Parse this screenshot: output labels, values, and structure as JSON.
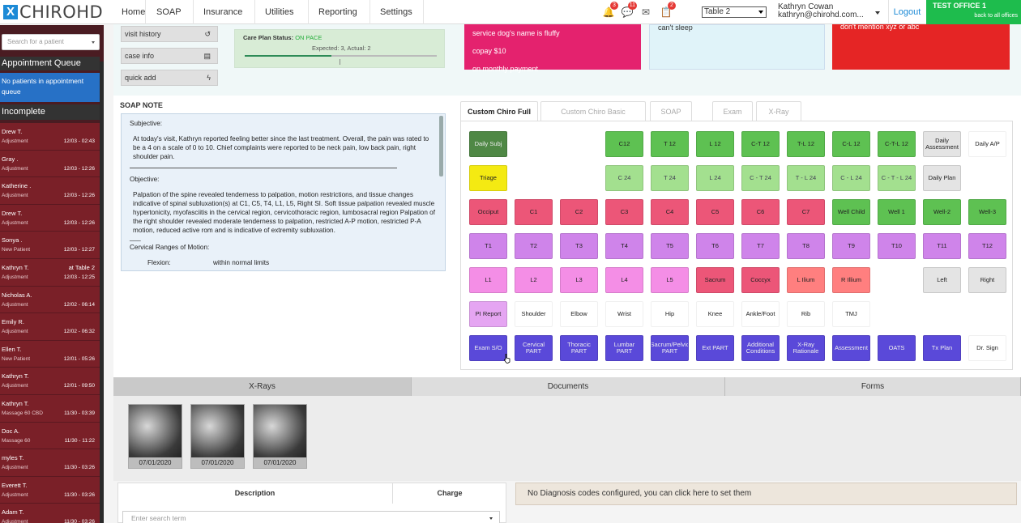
{
  "brand": {
    "logo_mark": "X",
    "logo_text": "CHIROHD"
  },
  "nav": {
    "items": [
      {
        "label": "Home",
        "dropdown": false
      },
      {
        "label": "SOAP",
        "dropdown": true
      },
      {
        "label": "Insurance",
        "dropdown": true
      },
      {
        "label": "Utilities",
        "dropdown": true
      },
      {
        "label": "Reporting",
        "dropdown": true
      },
      {
        "label": "Settings",
        "dropdown": true
      }
    ],
    "notifications": [
      {
        "icon": "bell-icon",
        "glyph": "🔔",
        "count": "3"
      },
      {
        "icon": "chat-icon",
        "glyph": "💬",
        "count": "11"
      },
      {
        "icon": "mail-icon",
        "glyph": "✉",
        "count": ""
      },
      {
        "icon": "clipboard-icon",
        "glyph": "📋",
        "count": "2"
      }
    ],
    "table_select": "Table 2",
    "user_name": "Kathryn Cowan",
    "user_email": "kathryn@chirohd.com...",
    "logout": "Logout",
    "office_title": "TEST OFFICE 1",
    "office_sub": "back to all offices"
  },
  "sidebar": {
    "search_placeholder": "Search for a patient",
    "queue_title": "Appointment Queue",
    "queue_empty": "No patients in appointment queue",
    "incomplete_title": "Incomplete",
    "patients": [
      {
        "name": "Drew T.",
        "type": "Adjustment",
        "time": "12/03 - 02:43",
        "table": ""
      },
      {
        "name": "Gray .",
        "type": "Adjustment",
        "time": "12/03 - 12:26",
        "table": ""
      },
      {
        "name": "Katherine .",
        "type": "Adjustment",
        "time": "12/03 - 12:26",
        "table": ""
      },
      {
        "name": "Drew T.",
        "type": "Adjustment",
        "time": "12/03 - 12:26",
        "table": ""
      },
      {
        "name": "Sonya .",
        "type": "New Patient",
        "time": "12/03 - 12:27",
        "table": ""
      },
      {
        "name": "Kathryn T.",
        "type": "Adjustment",
        "time": "12/03 - 12:25",
        "table": "at Table 2"
      },
      {
        "name": "Nicholas A.",
        "type": "Adjustment",
        "time": "12/02 - 06:14",
        "table": ""
      },
      {
        "name": "Emily R.",
        "type": "Adjustment",
        "time": "12/02 - 06:32",
        "table": ""
      },
      {
        "name": "Ellen T.",
        "type": "New Patient",
        "time": "12/01 - 05:26",
        "table": ""
      },
      {
        "name": "Kathryn T.",
        "type": "Adjustment",
        "time": "12/01 - 09:50",
        "table": ""
      },
      {
        "name": "Kathryn T.",
        "type": "Massage 60 CBD",
        "time": "11/30 - 03:39",
        "table": ""
      },
      {
        "name": "Doc A.",
        "type": "Massage 60",
        "time": "11/30 - 11:22",
        "table": ""
      },
      {
        "name": "myles T.",
        "type": "Adjustment",
        "time": "11/30 - 03:26",
        "table": ""
      },
      {
        "name": "Everett T.",
        "type": "Adjustment",
        "time": "11/30 - 03:26",
        "table": ""
      },
      {
        "name": "Adam T.",
        "type": "Adjustment",
        "time": "11/30 - 03:26",
        "table": ""
      }
    ]
  },
  "quick": {
    "visit_history": "visit history",
    "case_info": "case info",
    "quick_add": "quick add"
  },
  "care_plan": {
    "label": "Care Plan Status:",
    "value": "ON PACE",
    "expected": "Expected: 3, Actual: 2",
    "progress": 0.45
  },
  "notes": {
    "pink": [
      "service dog's name is fluffy",
      "copay $10",
      "on monthly payment"
    ],
    "blue": "can't sleep",
    "red": "don't mention xyz or abc"
  },
  "soap": {
    "title": "SOAP NOTE",
    "subjective_h": "Subjective:",
    "subjective": "At today's visit, Kathryn reported feeling better since the last treatment.  Overall, the pain was rated to be a 4 on a scale of 0 to 10.  Chief complaints were reported to be neck pain, low back pain, right shoulder pain.",
    "objective_h": "Objective:",
    "objective": "Palpation of the spine revealed tenderness to palpation, motion restrictions, and tissue changes indicative of spinal subluxation(s) at C1, C5, T4, L1, L5, Right SI. Soft tissue palpation revealed muscle hypertonicity,  myofasciitis in the cervical region,  cervicothoracic region,  lumbosacral region Palpation of the right shoulder revealed moderate tenderness to palpation, restricted A-P motion, restricted P-A motion, reduced active rom and is indicative of extremity subluxation.",
    "sep": "___",
    "cervical_h": "Cervical Ranges of Motion:",
    "flexion": "Flexion:",
    "flexion_v": "within normal limits"
  },
  "tabs": [
    "Custom Chiro Full",
    "Custom Chiro Basic",
    "SOAP",
    "Exam",
    "X-Ray"
  ],
  "grid": [
    [
      {
        "l": "Daily Subj",
        "c": "gs"
      },
      {
        "l": "",
        "c": ""
      },
      {
        "l": "",
        "c": ""
      },
      {
        "l": "C12",
        "c": "g"
      },
      {
        "l": "T 12",
        "c": "g"
      },
      {
        "l": "L 12",
        "c": "g"
      },
      {
        "l": "C-T 12",
        "c": "g"
      },
      {
        "l": "T-L 12",
        "c": "g"
      },
      {
        "l": "C-L 12",
        "c": "g"
      },
      {
        "l": "C-T-L 12",
        "c": "g"
      },
      {
        "l": "Daily Assessment",
        "c": "gr"
      },
      {
        "l": "Daily A/P",
        "c": "w"
      }
    ],
    [
      {
        "l": "Triage",
        "c": "y"
      },
      {
        "l": "",
        "c": ""
      },
      {
        "l": "",
        "c": ""
      },
      {
        "l": "C 24",
        "c": "lg"
      },
      {
        "l": "T 24",
        "c": "lg"
      },
      {
        "l": "L 24",
        "c": "lg"
      },
      {
        "l": "C - T 24",
        "c": "lg"
      },
      {
        "l": "T - L 24",
        "c": "lg"
      },
      {
        "l": "C - L 24",
        "c": "lg"
      },
      {
        "l": "C - T - L 24",
        "c": "lg"
      },
      {
        "l": "Daily Plan",
        "c": "gr"
      },
      {
        "l": "",
        "c": ""
      }
    ],
    [
      {
        "l": "Occiput",
        "c": "r"
      },
      {
        "l": "C1",
        "c": "r"
      },
      {
        "l": "C2",
        "c": "r"
      },
      {
        "l": "C3",
        "c": "r"
      },
      {
        "l": "C4",
        "c": "r"
      },
      {
        "l": "C5",
        "c": "r"
      },
      {
        "l": "C6",
        "c": "r"
      },
      {
        "l": "C7",
        "c": "r"
      },
      {
        "l": "Well Child",
        "c": "g"
      },
      {
        "l": "Well 1",
        "c": "g"
      },
      {
        "l": "Well-2",
        "c": "g"
      },
      {
        "l": "Well-3",
        "c": "g"
      }
    ],
    [
      {
        "l": "T1",
        "c": "p"
      },
      {
        "l": "T2",
        "c": "p"
      },
      {
        "l": "T3",
        "c": "p"
      },
      {
        "l": "T4",
        "c": "p"
      },
      {
        "l": "T5",
        "c": "p"
      },
      {
        "l": "T6",
        "c": "p"
      },
      {
        "l": "T7",
        "c": "p"
      },
      {
        "l": "T8",
        "c": "p"
      },
      {
        "l": "T9",
        "c": "p"
      },
      {
        "l": "T10",
        "c": "p"
      },
      {
        "l": "T11",
        "c": "p"
      },
      {
        "l": "T12",
        "c": "p"
      }
    ],
    [
      {
        "l": "L1",
        "c": "pk"
      },
      {
        "l": "L2",
        "c": "pk"
      },
      {
        "l": "L3",
        "c": "pk"
      },
      {
        "l": "L4",
        "c": "pk"
      },
      {
        "l": "L5",
        "c": "pk"
      },
      {
        "l": "Sacrum",
        "c": "r"
      },
      {
        "l": "Coccyx",
        "c": "r"
      },
      {
        "l": "L Ilium",
        "c": "sal"
      },
      {
        "l": "R Illium",
        "c": "sal"
      },
      {
        "l": "",
        "c": ""
      },
      {
        "l": "Left",
        "c": "gr"
      },
      {
        "l": "Right",
        "c": "gr"
      }
    ],
    [
      {
        "l": "PI Report",
        "c": "pp"
      },
      {
        "l": "Shoulder",
        "c": "w"
      },
      {
        "l": "Elbow",
        "c": "w"
      },
      {
        "l": "Wrist",
        "c": "w"
      },
      {
        "l": "Hip",
        "c": "w"
      },
      {
        "l": "Knee",
        "c": "w"
      },
      {
        "l": "Ankle/Foot",
        "c": "w"
      },
      {
        "l": "Rib",
        "c": "w"
      },
      {
        "l": "TMJ",
        "c": "w"
      },
      {
        "l": "",
        "c": ""
      },
      {
        "l": "",
        "c": ""
      },
      {
        "l": "",
        "c": ""
      }
    ],
    [
      {
        "l": "Exam S/O",
        "c": "b"
      },
      {
        "l": "Cervical PART",
        "c": "b"
      },
      {
        "l": "Thoracic PART",
        "c": "b"
      },
      {
        "l": "Lumbar PART",
        "c": "b"
      },
      {
        "l": "Sacrum/Pelvic PART",
        "c": "b"
      },
      {
        "l": "Ext PART",
        "c": "b"
      },
      {
        "l": "Additional Conditions",
        "c": "b"
      },
      {
        "l": "X-Ray Rationale",
        "c": "b"
      },
      {
        "l": "Assessment",
        "c": "b"
      },
      {
        "l": "OATS",
        "c": "b"
      },
      {
        "l": "Tx Plan",
        "c": "b"
      },
      {
        "l": "Dr. Sign",
        "c": "w"
      }
    ]
  ],
  "bottom_tabs": [
    "X-Rays",
    "Documents",
    "Forms"
  ],
  "xrays": [
    "07/01/2020",
    "07/01/2020",
    "07/01/2020"
  ],
  "billing": {
    "description": "Description",
    "charge": "Charge",
    "search_placeholder": "Enter search term",
    "diagnosis_msg": "No Diagnosis codes configured, you can click here to set them"
  }
}
